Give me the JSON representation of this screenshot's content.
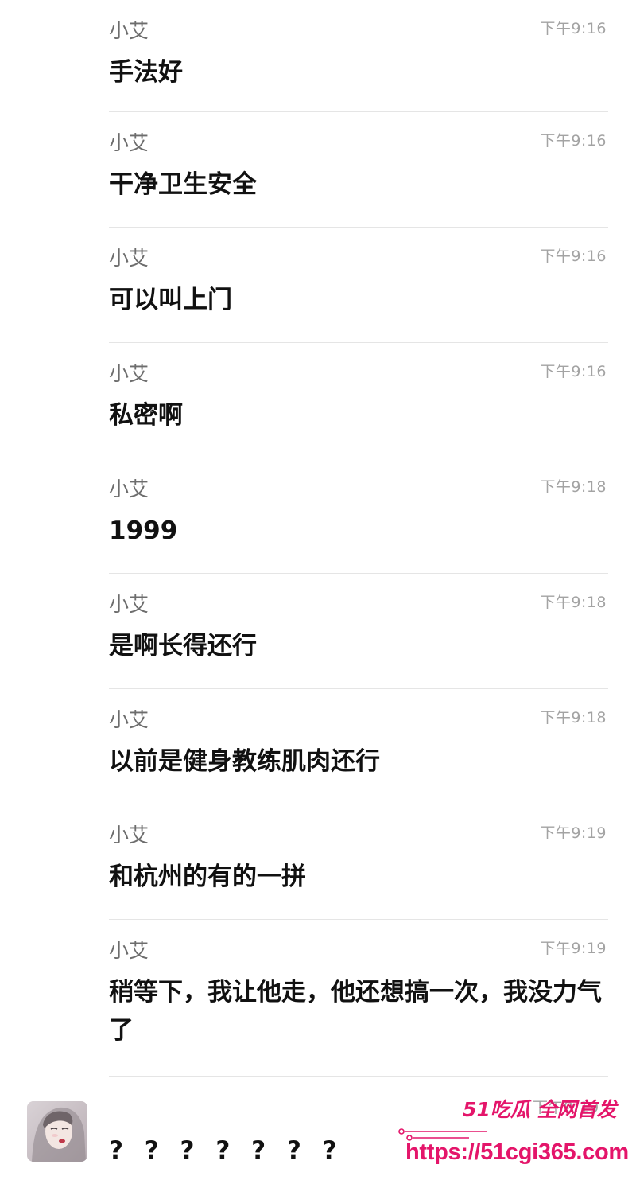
{
  "messages": [
    {
      "sender": "小艾",
      "time": "下午9:16",
      "text": "手法好"
    },
    {
      "sender": "小艾",
      "time": "下午9:16",
      "text": "干净卫生安全"
    },
    {
      "sender": "小艾",
      "time": "下午9:16",
      "text": "可以叫上门"
    },
    {
      "sender": "小艾",
      "time": "下午9:16",
      "text": "私密啊"
    },
    {
      "sender": "小艾",
      "time": "下午9:18",
      "text": "1999"
    },
    {
      "sender": "小艾",
      "time": "下午9:18",
      "text": "是啊长得还行"
    },
    {
      "sender": "小艾",
      "time": "下午9:18",
      "text": "以前是健身教练肌肉还行"
    },
    {
      "sender": "小艾",
      "time": "下午9:19",
      "text": "和杭州的有的一拼"
    },
    {
      "sender": "小艾",
      "time": "下午9:19",
      "text": "稍等下，我让他走，他还想搞一次，我没力气了"
    }
  ],
  "last_message": {
    "time": "下午9:19",
    "text": "? ? ? ? ? ? ?"
  },
  "watermark": {
    "brand": "51吃瓜 全网首发",
    "url": "https://51cgi365.com"
  },
  "colors": {
    "watermark": "#e4156a",
    "sender": "#6d6d6d",
    "time": "#a3a3a3",
    "divider": "#e5e5e5"
  }
}
